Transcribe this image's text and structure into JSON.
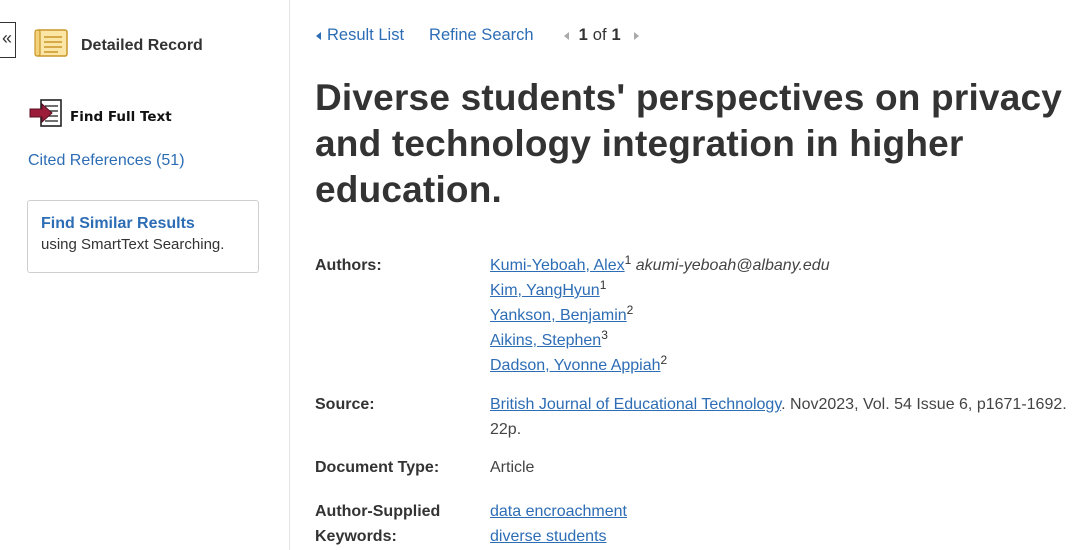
{
  "sidebar": {
    "collapse": "«",
    "detailed_record": "Detailed Record",
    "find_full_text": "Find Full Text",
    "cited_references": "Cited References (51)",
    "similar_title": "Find Similar Results",
    "similar_sub": "using SmartText Searching."
  },
  "nav": {
    "result_list": "Result List",
    "refine_search": "Refine Search",
    "pager_current": "1",
    "pager_of": "of",
    "pager_total": "1"
  },
  "record": {
    "title_lines": [
      "Diverse students' perspectives on privacy",
      "and technology integration in higher",
      "education."
    ],
    "labels": {
      "authors": "Authors:",
      "source": "Source:",
      "doc_type": "Document Type:",
      "keywords_1": "Author-Supplied",
      "keywords_2": "Keywords:"
    },
    "authors": [
      {
        "name": "Kumi-Yeboah, Alex",
        "sup": "1",
        "email": "akumi-yeboah@albany.edu"
      },
      {
        "name": "Kim, YangHyun",
        "sup": "1"
      },
      {
        "name": "Yankson, Benjamin",
        "sup": "2"
      },
      {
        "name": "Aikins, Stephen",
        "sup": "3"
      },
      {
        "name": "Dadson, Yvonne Appiah",
        "sup": "2"
      }
    ],
    "source_link": "British Journal of Educational Technology",
    "source_rest": ". Nov2023, Vol. 54 Issue 6, p1671-1692.",
    "source_pages": "22p.",
    "doc_type": "Article",
    "keywords": [
      "data encroachment",
      "diverse students"
    ]
  },
  "colors": {
    "link": "#2d6db5",
    "text": "#333333"
  },
  "icons": {
    "detailed_record": "document-record-icon",
    "find_full_text": "full-text-arrow-icon"
  }
}
